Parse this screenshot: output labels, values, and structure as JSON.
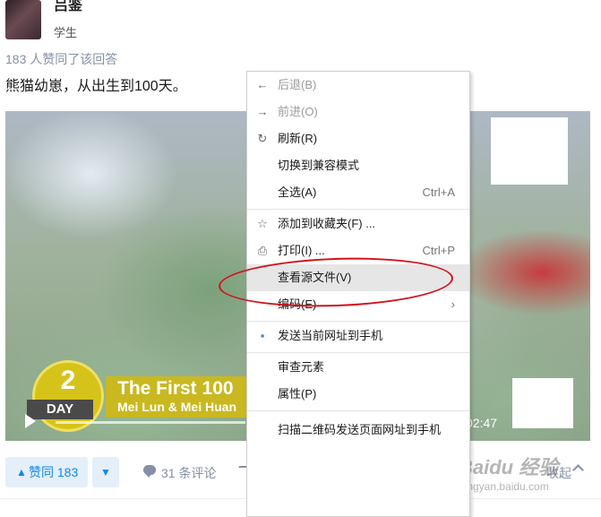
{
  "author": {
    "name": "吕鉴",
    "subtitle": "学生"
  },
  "votes_line": "183 人赞同了该回答",
  "answer_text": "熊猫幼崽，从出生到100天。",
  "video": {
    "day_number": "2",
    "day_label": "DAY",
    "title_main": "The First 100",
    "title_sub": "Mei Lun & Mei Huan",
    "time": "02:47"
  },
  "actions": {
    "vote_arrow": "▲",
    "vote_label": "赞同 183",
    "downvote_arrow": "▼",
    "comments": "31 条评论",
    "collapse": "收起"
  },
  "context_menu": {
    "items": [
      {
        "label": "后退(B)",
        "shortcut": "",
        "icon": "←"
      },
      {
        "label": "前进(O)",
        "shortcut": "",
        "icon": "→"
      },
      {
        "label": "刷新(R)",
        "shortcut": "",
        "icon": "↻"
      },
      {
        "label": "切换到兼容模式",
        "shortcut": "",
        "icon": ""
      },
      {
        "label": "全选(A)",
        "shortcut": "Ctrl+A",
        "icon": ""
      },
      {
        "label": "添加到收藏夹(F) ...",
        "shortcut": "",
        "icon": "☆"
      },
      {
        "label": "打印(I) ...",
        "shortcut": "Ctrl+P",
        "icon": "⎙"
      },
      {
        "label": "查看源文件(V)",
        "shortcut": "",
        "icon": ""
      },
      {
        "label": "编码(E)",
        "shortcut": "›",
        "icon": ""
      },
      {
        "label": "发送当前网址到手机",
        "shortcut": "",
        "icon": "▪"
      },
      {
        "label": "审查元素",
        "shortcut": "",
        "icon": ""
      },
      {
        "label": "属性(P)",
        "shortcut": "",
        "icon": ""
      },
      {
        "label": "扫描二维码发送页面网址到手机",
        "shortcut": "",
        "icon": ""
      }
    ]
  },
  "watermark": {
    "logo": "Baidu 经验",
    "url": "jingyan.baidu.com"
  },
  "colors": {
    "accent": "#0f88eb",
    "annotation": "#d0131b",
    "muted": "#8590a6"
  }
}
